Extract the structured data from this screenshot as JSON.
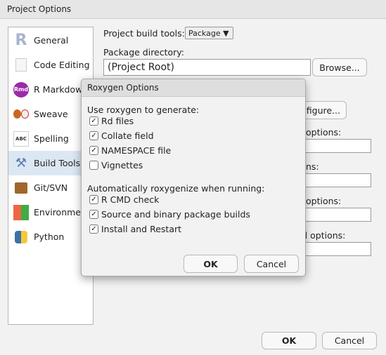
{
  "window": {
    "title": "Project Options"
  },
  "sidebar": {
    "items": [
      {
        "label": "General",
        "icon": "r-logo-icon"
      },
      {
        "label": "Code Editing",
        "icon": "document-icon"
      },
      {
        "label": "R Markdown",
        "icon": "rmd-icon"
      },
      {
        "label": "Sweave",
        "icon": "sweave-icon"
      },
      {
        "label": "Spelling",
        "icon": "spelling-icon"
      },
      {
        "label": "Build Tools",
        "icon": "tools-icon",
        "selected": true
      },
      {
        "label": "Git/SVN",
        "icon": "box-icon"
      },
      {
        "label": "Environments",
        "icon": "environments-icon"
      },
      {
        "label": "Python",
        "icon": "python-icon"
      }
    ]
  },
  "build": {
    "tools_label": "Project build tools:",
    "tools_value": "Package",
    "dir_label": "Package directory:",
    "dir_value": "(Project Root)",
    "browse": "Browse...",
    "configure": "figure...",
    "opt1": "options:",
    "opt2": "ns:",
    "opt3": "options:",
    "opt4": "al options:"
  },
  "dialog": {
    "title": "Roxygen Options",
    "generate_label": "Use roxygen to generate:",
    "generate": [
      {
        "label": "Rd files",
        "checked": true
      },
      {
        "label": "Collate field",
        "checked": true
      },
      {
        "label": "NAMESPACE file",
        "checked": true
      },
      {
        "label": "Vignettes",
        "checked": false
      }
    ],
    "auto_label": "Automatically roxygenize when running:",
    "auto": [
      {
        "label": "R CMD check",
        "checked": true
      },
      {
        "label": "Source and binary package builds",
        "checked": true
      },
      {
        "label": "Install and Restart",
        "checked": true
      }
    ],
    "ok": "OK",
    "cancel": "Cancel"
  },
  "footer": {
    "ok": "OK",
    "cancel": "Cancel"
  }
}
